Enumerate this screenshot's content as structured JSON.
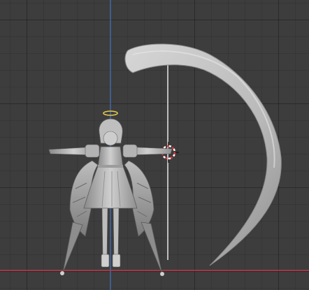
{
  "viewport": {
    "grid_visible": true,
    "colors": {
      "background": "#3d3d3d",
      "grid_line": "#2f2f2f",
      "x_axis": "#c0394b",
      "y_axis": "#4a78c5",
      "mesh_light": "#c9c9c9",
      "mesh_mid": "#a8a8a8",
      "mesh_dark": "#6e6e6e",
      "cursor_red": "#e0323c",
      "halo": "#e6c84e"
    }
  },
  "scene_objects": [
    {
      "name": "character-mesh",
      "type": "mesh"
    },
    {
      "name": "curved-blade",
      "type": "mesh"
    },
    {
      "name": "pole-shaft",
      "type": "mesh"
    },
    {
      "name": "3d-cursor",
      "type": "cursor"
    }
  ]
}
